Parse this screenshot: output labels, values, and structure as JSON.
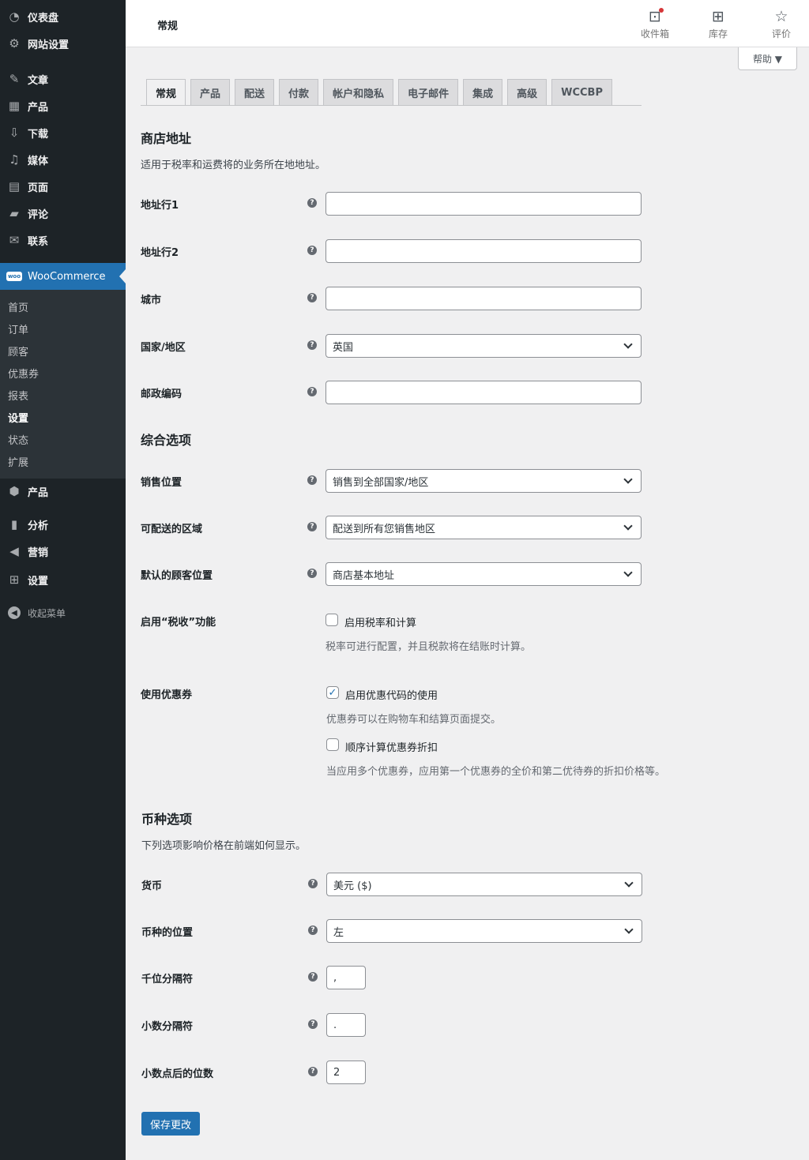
{
  "sidebar": {
    "dashboard": "仪表盘",
    "site_settings": "网站设置",
    "posts": "文章",
    "products_top": "产品",
    "downloads": "下载",
    "media": "媒体",
    "pages": "页面",
    "comments": "评论",
    "contact": "联系",
    "woocommerce": "WooCommerce",
    "woo_icon_text": "woo",
    "submenu": [
      "首页",
      "订单",
      "顾客",
      "优惠券",
      "报表",
      "设置",
      "状态",
      "扩展"
    ],
    "products": "产品",
    "analytics": "分析",
    "marketing": "营销",
    "settings": "设置",
    "collapse": "收起菜单"
  },
  "topbar": {
    "heading": "常规",
    "inbox": "收件箱",
    "stock": "库存",
    "review": "评价"
  },
  "help": "帮助 ▼",
  "tabs": [
    "常规",
    "产品",
    "配送",
    "付款",
    "帐户和隐私",
    "电子邮件",
    "集成",
    "高级",
    "WCCBP"
  ],
  "store_address": {
    "title": "商店地址",
    "desc": "适用于税率和运费将的业务所在地地址。",
    "address1_label": "地址行1",
    "address2_label": "地址行2",
    "city_label": "城市",
    "country_label": "国家/地区",
    "country_value": "英国",
    "postcode_label": "邮政编码"
  },
  "general": {
    "title": "综合选项",
    "sell_label": "销售位置",
    "sell_value": "销售到全部国家/地区",
    "ship_label": "可配送的区域",
    "ship_value": "配送到所有您销售地区",
    "default_loc_label": "默认的顾客位置",
    "default_loc_value": "商店基本地址",
    "tax_label": "启用“税收”功能",
    "tax_cb": "启用税率和计算",
    "tax_desc": "税率可进行配置，并且税款将在结账时计算。",
    "coupon_label": "使用优惠券",
    "coupon_cb1": "启用优惠代码的使用",
    "coupon_desc1": "优惠券可以在购物车和结算页面提交。",
    "coupon_cb2": "顺序计算优惠券折扣",
    "coupon_desc2": "当应用多个优惠券，应用第一个优惠券的全价和第二优待券的折扣价格等。"
  },
  "currency": {
    "title": "币种选项",
    "desc": "下列选项影响价格在前端如何显示。",
    "currency_label": "货币",
    "currency_value": "美元 ($)",
    "position_label": "币种的位置",
    "position_value": "左",
    "thousand_label": "千位分隔符",
    "thousand_value": ",",
    "decimal_label": "小数分隔符",
    "decimal_value": ".",
    "decimals_label": "小数点后的位数",
    "decimals_value": "2"
  },
  "help_tip_glyph": "?",
  "save": "保存更改"
}
